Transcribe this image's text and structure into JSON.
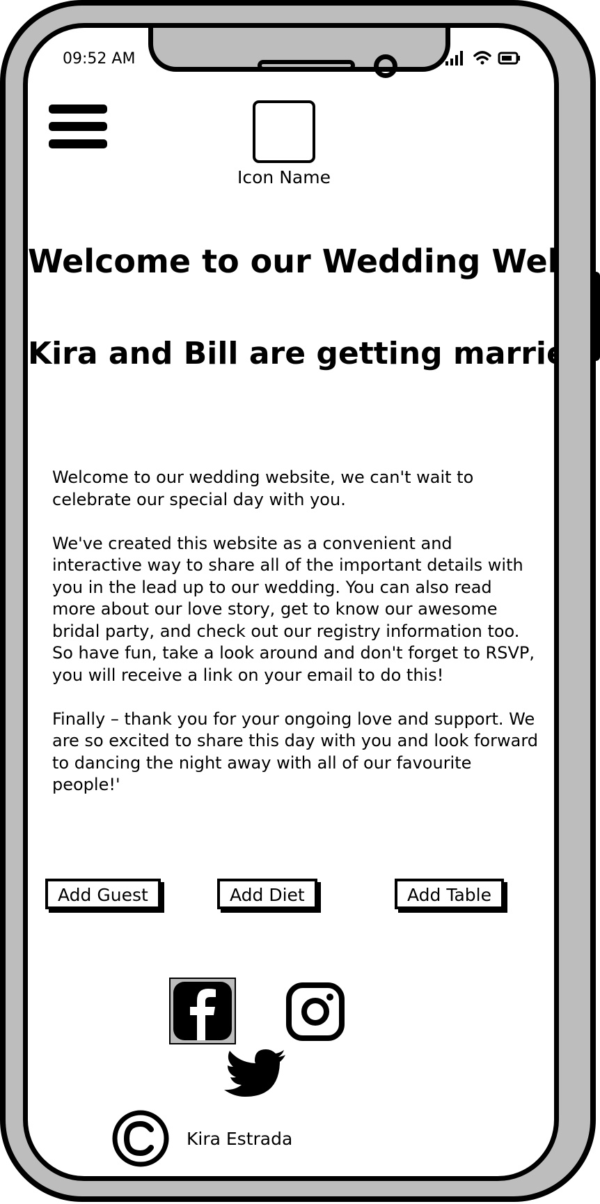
{
  "status_bar": {
    "time": "09:52 AM",
    "icons": [
      "signal-icon",
      "wifi-icon",
      "battery-icon"
    ]
  },
  "header": {
    "menu_icon": "hamburger-menu-icon",
    "icon_name": "Icon Name"
  },
  "hero": {
    "title": "Welcome to our Wedding Website",
    "subtitle": "Kira and Bill are getting married!"
  },
  "intro": {
    "paragraphs": [
      "Welcome to our wedding website, we can't wait to celebrate our special day with you.",
      "We've created this website as a convenient and interactive way to share all of the important details with you in the lead up to our wedding. You can also read more about our love story, get to know our awesome bridal party, and check out our registry information too. So have fun, take a look around and don't forget to RSVP, you will receive a link on your email to do this!",
      "Finally – thank you for your ongoing love and support. We are so excited to share this day with you and look forward to dancing the night away with all of our favourite people!'"
    ]
  },
  "actions": {
    "add_guest": "Add Guest",
    "add_diet": "Add Diet",
    "add_table": "Add Table"
  },
  "social": [
    "facebook-icon",
    "instagram-icon",
    "twitter-icon"
  ],
  "footer": {
    "author": "Kira Estrada"
  },
  "colors": {
    "frame": "#bdbdbd",
    "ink": "#000000",
    "screen": "#ffffff"
  }
}
